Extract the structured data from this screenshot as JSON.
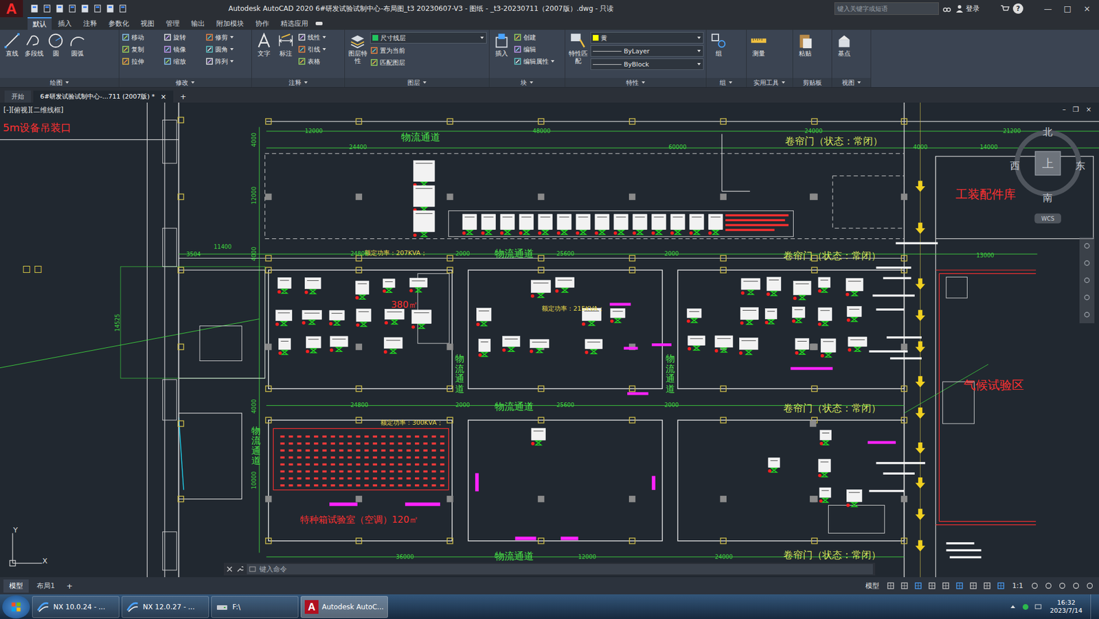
{
  "titlebar": {
    "app_logo": "A",
    "title": "Autodesk AutoCAD 2020    6#研发试验试制中心-布局图_t3 20230607-V3 - 图纸 - _t3-20230711（2007版）.dwg - 只读",
    "search_placeholder": "键入关键字或短语",
    "login": "登录",
    "help": "?",
    "controls": [
      "—",
      "□",
      "×"
    ]
  },
  "ribbon_tabs": [
    {
      "label": "默认",
      "selected": true
    },
    {
      "label": "插入",
      "selected": false
    },
    {
      "label": "注释",
      "selected": false
    },
    {
      "label": "参数化",
      "selected": false
    },
    {
      "label": "视图",
      "selected": false
    },
    {
      "label": "管理",
      "selected": false
    },
    {
      "label": "输出",
      "selected": false
    },
    {
      "label": "附加模块",
      "selected": false
    },
    {
      "label": "协作",
      "selected": false
    },
    {
      "label": "精选应用",
      "selected": false
    }
  ],
  "ribbon_panels": [
    {
      "title": "绘图",
      "dropdown": true,
      "large": [
        {
          "label": "直线"
        },
        {
          "label": "多段线"
        },
        {
          "label": "圆"
        },
        {
          "label": "圆弧"
        }
      ],
      "combos": [],
      "small": []
    },
    {
      "title": "修改",
      "dropdown": true,
      "large": [],
      "combos": [],
      "small": [
        {
          "label": "移动",
          "dropdown": false
        },
        {
          "label": "旋转",
          "dropdown": false
        },
        {
          "label": "修剪",
          "dropdown": true
        },
        {
          "label": "复制",
          "dropdown": false
        },
        {
          "label": "镜像",
          "dropdown": false
        },
        {
          "label": "圆角",
          "dropdown": true
        },
        {
          "label": "拉伸",
          "dropdown": false
        },
        {
          "label": "缩放",
          "dropdown": false
        },
        {
          "label": "阵列",
          "dropdown": true
        }
      ]
    },
    {
      "title": "注释",
      "dropdown": true,
      "large": [
        {
          "label": "文字"
        },
        {
          "label": "标注"
        }
      ],
      "combos": [],
      "small": [
        {
          "label": "线性",
          "dropdown": true
        },
        {
          "label": "引线",
          "dropdown": true
        },
        {
          "label": "表格",
          "dropdown": false
        }
      ]
    },
    {
      "title": "图层",
      "dropdown": true,
      "large": [
        {
          "label": "图层特性"
        }
      ],
      "combos": [
        {
          "value": "尺寸线层",
          "swatch": "#22c55e"
        }
      ],
      "small": [
        {
          "label": "置为当前",
          "dropdown": false
        },
        {
          "label": "匹配图层",
          "dropdown": false
        }
      ]
    },
    {
      "title": "块",
      "dropdown": true,
      "large": [
        {
          "label": "插入"
        }
      ],
      "combos": [],
      "small": [
        {
          "label": "创建",
          "dropdown": false
        },
        {
          "label": "编辑",
          "dropdown": false
        },
        {
          "label": "编辑属性",
          "dropdown": true
        }
      ]
    },
    {
      "title": "特性",
      "dropdown": true,
      "large": [
        {
          "label": "特性匹配"
        }
      ],
      "combos": [
        {
          "value": "黄",
          "swatch": "#ffff00"
        },
        {
          "value": "ByLayer",
          "swatch": ""
        },
        {
          "value": "ByBlock",
          "swatch": ""
        }
      ],
      "small": []
    },
    {
      "title": "组",
      "dropdown": true,
      "large": [
        {
          "label": "组"
        }
      ],
      "combos": [],
      "small": []
    },
    {
      "title": "实用工具",
      "dropdown": true,
      "large": [
        {
          "label": "测量"
        }
      ],
      "combos": [],
      "small": []
    },
    {
      "title": "剪贴板",
      "dropdown": false,
      "large": [
        {
          "label": "粘贴"
        }
      ],
      "combos": [],
      "small": []
    },
    {
      "title": "视图",
      "dropdown": true,
      "large": [
        {
          "label": "基点"
        }
      ],
      "combos": [],
      "small": []
    }
  ],
  "doc_tabs": [
    {
      "label": "开始",
      "selected": false,
      "closable": false
    },
    {
      "label": "6#研发试验试制中心-...711 (2007版) *",
      "selected": true,
      "closable": true
    }
  ],
  "doc_tab_close": "×",
  "new_tab": "+",
  "viewport": {
    "label": "[-][俯视][二维线框]",
    "controls": [
      "–",
      "❐",
      "×"
    ]
  },
  "drawing_labels": [
    {
      "text": "5m设备吊装口",
      "color": "#ff3030",
      "kind": "h"
    },
    {
      "text": "□ □",
      "color": "#e8d84a",
      "kind": "h"
    },
    {
      "text": "物流通道",
      "color": "#49e449",
      "kind": "h"
    },
    {
      "text": "物流通道",
      "color": "#49e449",
      "kind": "h"
    },
    {
      "text": "物流通道",
      "color": "#49e449",
      "kind": "h"
    },
    {
      "text": "物流通道",
      "color": "#49e449",
      "kind": "h"
    },
    {
      "text": "卷帘门（状态：常闭）",
      "color": "#d4e45a",
      "kind": "h"
    },
    {
      "text": "卷帘门（状态：常闭）",
      "color": "#d4e45a",
      "kind": "h"
    },
    {
      "text": "卷帘门（状态：常闭）",
      "color": "#d4e45a",
      "kind": "h"
    },
    {
      "text": "卷帘门（状态：常闭）",
      "color": "#d4e45a",
      "kind": "h"
    },
    {
      "text": "工装配件库",
      "color": "#ff3030",
      "kind": "h"
    },
    {
      "text": "气候试验区",
      "color": "#ff3030",
      "kind": "h"
    },
    {
      "text": "物流通道",
      "color": "#49e449",
      "kind": "v"
    },
    {
      "text": "物流通道",
      "color": "#49e449",
      "kind": "v"
    },
    {
      "text": "物流通道",
      "color": "#49e449",
      "kind": "v"
    },
    {
      "text": "额定功率：207KVA；",
      "color": "#e8d84a",
      "kind": "h"
    },
    {
      "text": "额定功率：215KVA；",
      "color": "#e8d84a",
      "kind": "h"
    },
    {
      "text": "额定功率：300KVA；",
      "color": "#e8d84a",
      "kind": "h"
    },
    {
      "text": "380㎡",
      "color": "#ff3030",
      "kind": "h"
    },
    {
      "text": "特种箱试验室（空调）120㎡",
      "color": "#ff3030",
      "kind": "h"
    },
    {
      "text": "12000",
      "color": "#3fd63f",
      "kind": "h"
    },
    {
      "text": "48000",
      "color": "#3fd63f",
      "kind": "h"
    },
    {
      "text": "24000",
      "color": "#3fd63f",
      "kind": "h"
    },
    {
      "text": "21200",
      "color": "#3fd63f",
      "kind": "h"
    },
    {
      "text": "24400",
      "color": "#3fd63f",
      "kind": "h"
    },
    {
      "text": "60000",
      "color": "#3fd63f",
      "kind": "h"
    },
    {
      "text": "4000",
      "color": "#3fd63f",
      "kind": "h"
    },
    {
      "text": "14000",
      "color": "#3fd63f",
      "kind": "h"
    },
    {
      "text": "11400",
      "color": "#3fd63f",
      "kind": "h"
    },
    {
      "text": "3504",
      "color": "#3fd63f",
      "kind": "h"
    },
    {
      "text": "24800",
      "color": "#3fd63f",
      "kind": "h"
    },
    {
      "text": "2000",
      "color": "#3fd63f",
      "kind": "h"
    },
    {
      "text": "25600",
      "color": "#3fd63f",
      "kind": "h"
    },
    {
      "text": "2000",
      "color": "#3fd63f",
      "kind": "h"
    },
    {
      "text": "13000",
      "color": "#3fd63f",
      "kind": "h"
    },
    {
      "text": "24800",
      "color": "#3fd63f",
      "kind": "h"
    },
    {
      "text": "2000",
      "color": "#3fd63f",
      "kind": "h"
    },
    {
      "text": "25600",
      "color": "#3fd63f",
      "kind": "h"
    },
    {
      "text": "2000",
      "color": "#3fd63f",
      "kind": "h"
    },
    {
      "text": "36000",
      "color": "#3fd63f",
      "kind": "h"
    },
    {
      "text": "12000",
      "color": "#3fd63f",
      "kind": "h"
    },
    {
      "text": "24000",
      "color": "#3fd63f",
      "kind": "h"
    },
    {
      "text": "4000",
      "color": "#3fd63f",
      "kind": "rot"
    },
    {
      "text": "12000",
      "color": "#3fd63f",
      "kind": "rot"
    },
    {
      "text": "4000",
      "color": "#3fd63f",
      "kind": "rot"
    },
    {
      "text": "4000",
      "color": "#3fd63f",
      "kind": "rot"
    },
    {
      "text": "10000",
      "color": "#3fd63f",
      "kind": "rot"
    },
    {
      "text": "14525",
      "color": "#3fd63f",
      "kind": "rot"
    }
  ],
  "compass": {
    "north": "北",
    "south": "南",
    "east": "东",
    "west": "西",
    "top": "上",
    "wcs": "WCS"
  },
  "ucs": {
    "y": "Y",
    "x": "X"
  },
  "command": {
    "placeholder": "键入命令"
  },
  "layout_tabs": [
    {
      "label": "模型",
      "selected": true
    },
    {
      "label": "布局1",
      "selected": false
    }
  ],
  "layout_add": "+",
  "status": {
    "mode": "模型",
    "scale": "1:1"
  },
  "taskbar": {
    "items": [
      {
        "label": "NX 10.0.24 - ...",
        "app": "nx",
        "active": false
      },
      {
        "label": "NX 12.0.27 - ...",
        "app": "nx",
        "active": false
      },
      {
        "label": "F:\\",
        "app": "folder",
        "active": false
      },
      {
        "label": "Autodesk AutoC...",
        "app": "acad",
        "active": true
      }
    ],
    "time": "16:32",
    "date": "2023/7/14"
  }
}
